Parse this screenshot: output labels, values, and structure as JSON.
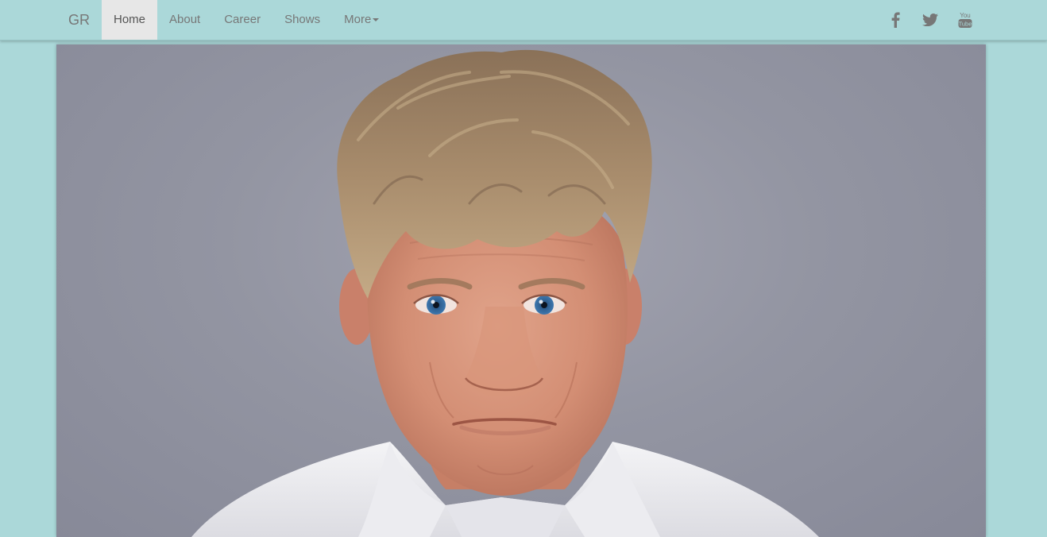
{
  "navbar": {
    "brand": "GR",
    "links": [
      {
        "label": "Home",
        "active": true
      },
      {
        "label": "About"
      },
      {
        "label": "Career"
      },
      {
        "label": "Shows"
      },
      {
        "label": "More"
      }
    ],
    "social": [
      {
        "icon": "facebook-icon"
      },
      {
        "icon": "twitter-icon"
      },
      {
        "icon": "youtube-icon",
        "text_top": "You",
        "text_bottom": "Tube"
      }
    ]
  },
  "colors": {
    "page_background": "#abd8d9",
    "nav_text": "#777777",
    "active_tab_background": "#e7e7e7",
    "photo_background": "#9395a2"
  }
}
